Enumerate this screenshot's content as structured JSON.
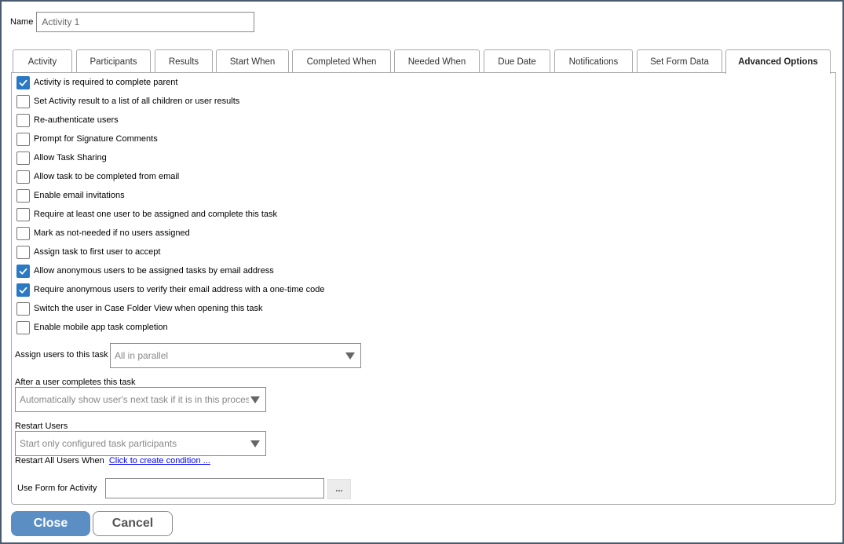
{
  "name_field": {
    "label": "Name",
    "value": "Activity 1"
  },
  "tabs": [
    {
      "label": "Activity"
    },
    {
      "label": "Participants"
    },
    {
      "label": "Results"
    },
    {
      "label": "Start When"
    },
    {
      "label": "Completed When"
    },
    {
      "label": "Needed When"
    },
    {
      "label": "Due Date"
    },
    {
      "label": "Notifications"
    },
    {
      "label": "Set Form Data"
    },
    {
      "label": "Advanced Options",
      "active": true
    }
  ],
  "options": [
    {
      "label": "Activity is required to complete parent",
      "checked": true
    },
    {
      "label": "Set Activity result to a list of all children or user results",
      "checked": false
    },
    {
      "label": "Re-authenticate users",
      "checked": false
    },
    {
      "label": "Prompt for Signature Comments",
      "checked": false
    },
    {
      "label": "Allow Task Sharing",
      "checked": false
    },
    {
      "label": "Allow task to be completed from email",
      "checked": false
    },
    {
      "label": "Enable email invitations",
      "checked": false
    },
    {
      "label": "Require at least one user to be assigned and complete this task",
      "checked": false
    },
    {
      "label": "Mark as not-needed if no users assigned",
      "checked": false
    },
    {
      "label": "Assign task to first user to accept",
      "checked": false
    },
    {
      "label": "Allow anonymous users to be assigned tasks by email address",
      "checked": true
    },
    {
      "label": "Require anonymous users to verify their email address with a one-time code",
      "checked": true
    },
    {
      "label": "Switch the user in Case Folder View when opening this task",
      "checked": false
    },
    {
      "label": "Enable mobile app task completion",
      "checked": false
    }
  ],
  "assign_users": {
    "label": "Assign users to this task",
    "value": "All in parallel"
  },
  "after_complete": {
    "label": "After a user completes this task",
    "value": "Automatically show user's next task if it is in this process"
  },
  "restart_users": {
    "label": "Restart Users",
    "value": "Start only configured task participants"
  },
  "restart_all": {
    "label": "Restart All Users When",
    "link": "Click to create condition ..."
  },
  "use_form": {
    "label": "Use Form for Activity",
    "value": "",
    "button": "..."
  },
  "buttons": {
    "close": "Close",
    "cancel": "Cancel"
  },
  "colors": {
    "accent": "#2b79c2",
    "close_button": "#5b8fc4",
    "border": "#4a5b70"
  },
  "icons": {
    "checkbox_check": "check-icon",
    "dropdown": "chevron-down-icon"
  }
}
